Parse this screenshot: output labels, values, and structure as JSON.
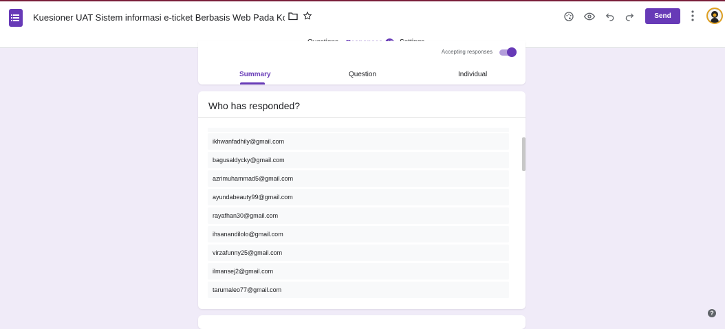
{
  "header": {
    "title": "Kuesioner UAT Sistem informasi e-ticket Berbasis Web Pada Kolam Renang",
    "send_label": "Send",
    "icons": [
      "palette-icon",
      "eye-icon",
      "undo-icon",
      "redo-icon",
      "more-vert-icon"
    ]
  },
  "tabs": {
    "questions": "Questions",
    "responses": "Responses",
    "responses_count": "45",
    "settings": "Settings"
  },
  "summary": {
    "accepting_label": "Accepting responses",
    "tabs": [
      "Summary",
      "Question",
      "Individual"
    ]
  },
  "responded": {
    "title": "Who has responded?",
    "emails": [
      "ikhwanfadhily@gmail.com",
      "bagusaldycky@gmail.com",
      "azrimuhammad5@gmail.com",
      "ayundabeauty99@gmail.com",
      "rayafhan30@gmail.com",
      "ihsanandilolo@gmail.com",
      "virzafunny25@gmail.com",
      "ilmansej2@gmail.com",
      "tarumaleo77@gmail.com"
    ]
  },
  "help": "?",
  "colors": {
    "accent": "#673ab7",
    "background": "#f0ebf8"
  }
}
